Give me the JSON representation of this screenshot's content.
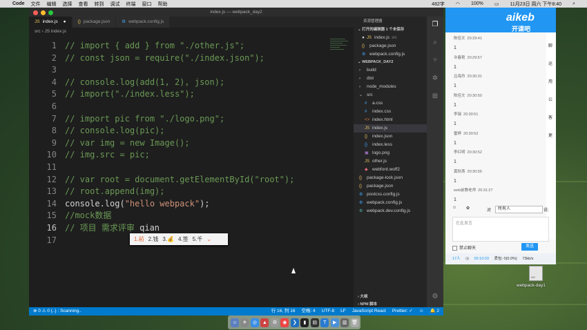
{
  "menubar": {
    "apple": "",
    "app": "Code",
    "items": [
      "文件",
      "编辑",
      "选择",
      "查看",
      "转到",
      "调试",
      "终端",
      "窗口",
      "帮助"
    ],
    "status": [
      "482字",
      "100%",
      "11月23日 周六 下午8:40"
    ]
  },
  "window": {
    "title": "index.js — webpack_day2"
  },
  "tabs": [
    {
      "icon": "JS",
      "label": "index.js",
      "modified": "●"
    },
    {
      "icon": "{}",
      "label": "package.json"
    },
    {
      "icon": "⚙",
      "label": "webpack.config.js"
    }
  ],
  "breadcrumb": "src  ›  JS  index.js",
  "code_lines": [
    {
      "n": "1",
      "segments": [
        {
          "t": "// import { add } from \"./other.js\";",
          "c": "cm"
        }
      ]
    },
    {
      "n": "2",
      "segments": [
        {
          "t": "// const json = require(\"./index.json\");",
          "c": "cm"
        }
      ]
    },
    {
      "n": "3",
      "segments": []
    },
    {
      "n": "4",
      "segments": [
        {
          "t": "// console.log(add(1, 2), json);",
          "c": "cm"
        }
      ]
    },
    {
      "n": "5",
      "segments": [
        {
          "t": "// import(\"./index.less\");",
          "c": "cm"
        }
      ]
    },
    {
      "n": "6",
      "segments": []
    },
    {
      "n": "7",
      "segments": [
        {
          "t": "// import pic from \"./logo.png\";",
          "c": "cm"
        }
      ]
    },
    {
      "n": "8",
      "segments": [
        {
          "t": "// console.log(pic);",
          "c": "cm"
        }
      ]
    },
    {
      "n": "9",
      "segments": [
        {
          "t": "// var img = new Image();",
          "c": "cm"
        }
      ]
    },
    {
      "n": "10",
      "segments": [
        {
          "t": "// img.src = pic;",
          "c": "cm"
        }
      ]
    },
    {
      "n": "11",
      "segments": []
    },
    {
      "n": "12",
      "segments": [
        {
          "t": "// var root = document.getElementById(\"root\");",
          "c": "cm"
        }
      ]
    },
    {
      "n": "13",
      "segments": [
        {
          "t": "// root.append(img);",
          "c": "cm"
        }
      ]
    },
    {
      "n": "14",
      "segments": [
        {
          "t": "console.log(",
          "c": "code"
        },
        {
          "t": "\"hello webpack\"",
          "c": "str"
        },
        {
          "t": ");",
          "c": "code"
        }
      ]
    },
    {
      "n": "15",
      "segments": [
        {
          "t": "//mock数据",
          "c": "cm"
        }
      ]
    },
    {
      "n": "16",
      "segments": [
        {
          "t": "// 项目 需求评审 ",
          "c": "cm"
        },
        {
          "t": "qian",
          "c": "code"
        }
      ]
    },
    {
      "n": "17",
      "segments": []
    }
  ],
  "ime": {
    "candidates": [
      "1.前",
      "2.钱",
      "3.💰",
      "4.签",
      "5.千"
    ],
    "more": "⌄"
  },
  "explorer": {
    "title": "资源管理器",
    "open_editors": "打开的编辑器   1 个未保存",
    "open_files": [
      {
        "icon": "JS",
        "name": "index.js",
        "note": "src",
        "mark": "●"
      },
      {
        "icon": "{}",
        "name": "package.json"
      },
      {
        "icon": "⚙",
        "name": "webpack.config.js"
      }
    ],
    "project": "WEBPACK_DAY2",
    "tree": [
      {
        "indent": 1,
        "icon": "›",
        "name": "build"
      },
      {
        "indent": 1,
        "icon": "›",
        "name": "dist"
      },
      {
        "indent": 1,
        "icon": "›",
        "name": "node_modules"
      },
      {
        "indent": 1,
        "icon": "⌄",
        "name": "src"
      },
      {
        "indent": 2,
        "icon": "#",
        "name": "a.css",
        "cls": "css"
      },
      {
        "indent": 2,
        "icon": "#",
        "name": "index.css",
        "cls": "css"
      },
      {
        "indent": 2,
        "icon": "<>",
        "name": "index.html",
        "cls": "html"
      },
      {
        "indent": 2,
        "icon": "JS",
        "name": "index.js",
        "sel": true
      },
      {
        "indent": 2,
        "icon": "{}",
        "name": "index.json",
        "cls": "json"
      },
      {
        "indent": 2,
        "icon": "{}",
        "name": "index.less",
        "cls": "css"
      },
      {
        "indent": 2,
        "icon": "▣",
        "name": "logo.png",
        "cls": "img"
      },
      {
        "indent": 2,
        "icon": "JS",
        "name": "other.js"
      },
      {
        "indent": 2,
        "icon": "◆",
        "name": "webfont.woff2",
        "cls": "font"
      },
      {
        "indent": 1,
        "icon": "{}",
        "name": "package-lock.json",
        "cls": "json"
      },
      {
        "indent": 1,
        "icon": "{}",
        "name": "package.json",
        "cls": "json"
      },
      {
        "indent": 1,
        "icon": "⚙",
        "name": "postcss.config.js",
        "cls": "cfg"
      },
      {
        "indent": 1,
        "icon": "⚙",
        "name": "webpack.config.js",
        "cls": "cfg"
      },
      {
        "indent": 1,
        "icon": "⚙",
        "name": "webpack.dev.config.js",
        "cls": "dev"
      }
    ],
    "outline": "大纲",
    "npm": "NPM 脚本"
  },
  "statusbar": {
    "left": "⊗ 0  ⚠ 0    {..} : Scanning..",
    "items": [
      "行 16, 列 16",
      "空格: 4",
      "UTF-8",
      "LF",
      "JavaScript React",
      "Prettier: ✓",
      "☺",
      "🔔 2"
    ]
  },
  "chat": {
    "logo": "aikeb",
    "logo_sub": "开课吧",
    "messages": [
      {
        "name": "陈佳文",
        "time": "20:29:41",
        "text": "1"
      },
      {
        "name": "许春艳",
        "time": "20:29:57",
        "text": "1"
      },
      {
        "name": "吕海舟",
        "time": "20:30:31",
        "text": "1"
      },
      {
        "name": "陈佳文",
        "time": "20:30:50",
        "text": "1"
      },
      {
        "name": "李瑞",
        "time": "20:30:51",
        "text": "1"
      },
      {
        "name": "雷婷",
        "time": "20:30:52",
        "text": "1"
      },
      {
        "name": "李红明",
        "time": "20:30:52",
        "text": "1"
      },
      {
        "name": "黄秋燕",
        "time": "20:30:56",
        "text": "1"
      },
      {
        "name": "web前教老师",
        "time": "20:31:27",
        "text": "1"
      }
    ],
    "to_label": "对",
    "to_value": "所有人",
    "say_label": "说:",
    "input_placeholder": "在此发言",
    "ban_label": "禁止聊天",
    "send_label": "发送",
    "status": [
      "17人",
      "00:10:03",
      "丢包: 0(0.0%)",
      "73kb/s"
    ],
    "side_labels": [
      "聊",
      "运",
      "用",
      "公",
      "客",
      "更"
    ]
  },
  "desktop_icon": {
    "badge": "NO",
    "label": "webpack-day1"
  }
}
